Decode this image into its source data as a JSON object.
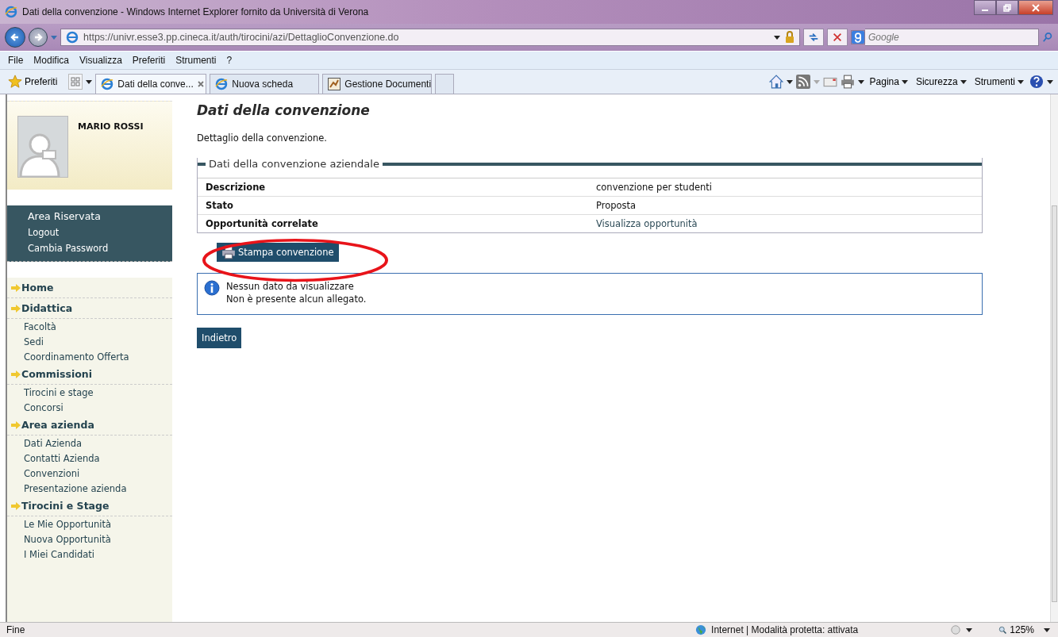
{
  "window": {
    "title": "Dati della convenzione - Windows Internet Explorer fornito da Università di Verona"
  },
  "address_bar": {
    "url": "https://univr.esse3.pp.cineca.it/auth/tirocini/azi/DettaglioConvenzione.do",
    "search_placeholder": "Google"
  },
  "menu_bar": [
    "File",
    "Modifica",
    "Visualizza",
    "Preferiti",
    "Strumenti",
    "?"
  ],
  "favorites_bar": {
    "favorites": "Preferiti",
    "tabs": [
      {
        "label": "Dati della conve...",
        "selected": true,
        "kind": "ie"
      },
      {
        "label": "Nuova scheda",
        "selected": false,
        "kind": "ie"
      },
      {
        "label": "Gestione Documenti",
        "selected": false,
        "kind": "doc"
      }
    ],
    "tools": [
      "Pagina",
      "Sicurezza",
      "Strumenti"
    ]
  },
  "sidebar": {
    "user": "MARIO ROSSI",
    "reserved": {
      "title": "Area Riservata",
      "links": [
        "Logout",
        "Cambia Password"
      ]
    },
    "sections": [
      {
        "title": "Home"
      },
      {
        "title": "Didattica",
        "items": [
          "Facoltà",
          "Sedi",
          "Coordinamento Offerta"
        ]
      },
      {
        "title": "Commissioni",
        "items": [
          "Tirocini e stage",
          "Concorsi"
        ]
      },
      {
        "title": "Area azienda",
        "items": [
          "Dati Azienda",
          "Contatti Azienda",
          "Convenzioni",
          "Presentazione azienda"
        ]
      },
      {
        "title": "Tirocini e Stage",
        "items": [
          "Le Mie Opportunità",
          "Nuova Opportunità",
          "I Miei Candidati"
        ]
      }
    ]
  },
  "main": {
    "heading": "Dati della convenzione",
    "intro": "Dettaglio della convenzione.",
    "panel": {
      "title": "Dati della convenzione aziendale",
      "rows": [
        {
          "label": "Descrizione",
          "value": "convenzione per studenti",
          "kind": "text"
        },
        {
          "label": "Stato",
          "value": "Proposta",
          "kind": "text"
        },
        {
          "label": "Opportunità correlate",
          "value": "Visualizza opportunità",
          "kind": "link"
        }
      ]
    },
    "print_button": "Stampa convenzione",
    "info": [
      "Nessun dato da visualizzare",
      "Non è presente alcun allegato."
    ],
    "back_button": "Indietro"
  },
  "status_bar": {
    "left": "Fine",
    "zone": "Internet | Modalità protetta: attivata",
    "zoom": "125%"
  }
}
